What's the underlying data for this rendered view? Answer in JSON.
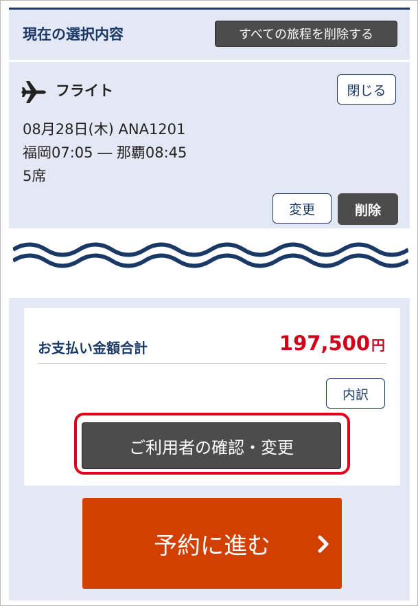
{
  "header": {
    "title": "現在の選択内容",
    "delete_all_label": "すべての旅程を削除する"
  },
  "flight": {
    "section_label": "フライト",
    "icon": "airplane-icon",
    "close_label": "閉じる",
    "date_flight": "08月28日(木) ANA1201",
    "route": "福岡07:05 ― 那覇08:45",
    "seats": "5席",
    "change_label": "変更",
    "delete_label": "削除"
  },
  "payment": {
    "label": "お支払い金額合計",
    "amount": "197,500",
    "unit": "円",
    "breakdown_label": "内訳",
    "confirm_label": "ご利用者の確認・変更"
  },
  "proceed": {
    "label": "予約に進む",
    "icon": "chevron-right-icon"
  },
  "colors": {
    "navy": "#1b3966",
    "panel_bg": "#e4e8f4",
    "dark_button": "#4c4c4c",
    "price_red": "#d0021b",
    "highlight_red": "#e4001b",
    "proceed_orange": "#d24000"
  }
}
